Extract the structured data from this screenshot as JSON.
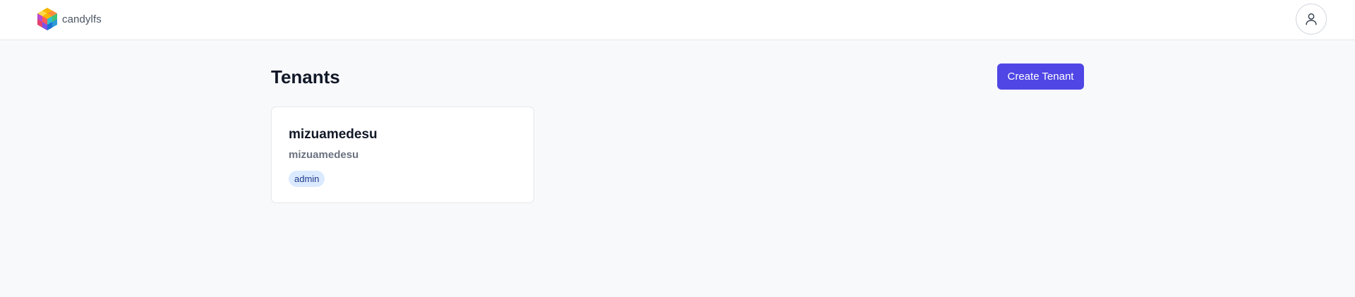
{
  "header": {
    "brand_name": "candylfs",
    "logo_icon": "colorful-cube-logo-icon",
    "user_icon": "user-icon"
  },
  "main": {
    "title": "Tenants",
    "create_button_label": "Create Tenant"
  },
  "tenants": [
    {
      "name": "mizuamedesu",
      "slug": "mizuamedesu",
      "role": "admin"
    }
  ],
  "colors": {
    "accent": "#4f46e5",
    "page_background": "#f8f9fb",
    "badge_background": "#dbeafe",
    "badge_text": "#1e3a8a"
  }
}
